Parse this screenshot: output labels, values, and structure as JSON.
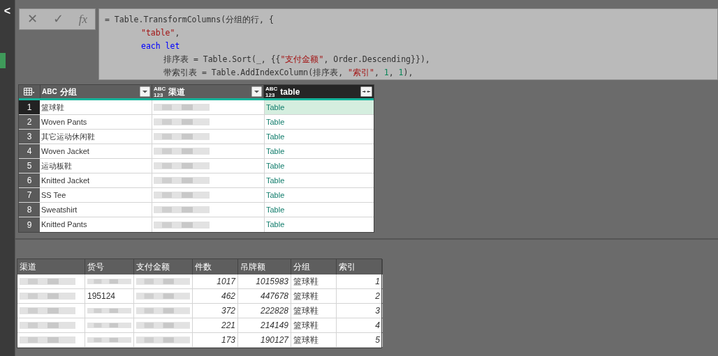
{
  "sidebar": {
    "collapse_icon": "<"
  },
  "formula_bar": {
    "buttons": [
      "✕",
      "✓",
      "fx"
    ],
    "code_lines": [
      {
        "tokens": [
          {
            "kind": "plain",
            "text": "= Table.TransformColumns(分组的行, {"
          }
        ],
        "children": [
          {
            "tokens": [
              {
                "kind": "string",
                "text": "\"table\""
              },
              {
                "kind": "plain",
                "text": ","
              }
            ]
          },
          {
            "tokens": [
              {
                "kind": "keyword",
                "text": "each let"
              }
            ],
            "children": [
              {
                "tokens": [
                  {
                    "kind": "plain",
                    "text": "排序表 = Table.Sort(_, {{"
                  },
                  {
                    "kind": "string",
                    "text": "\"支付金额\""
                  },
                  {
                    "kind": "plain",
                    "text": ", Order.Descending}}),"
                  }
                ]
              },
              {
                "tokens": [
                  {
                    "kind": "plain",
                    "text": "带索引表 = Table.AddIndexColumn(排序表, "
                  },
                  {
                    "kind": "string",
                    "text": "\"索引\""
                  },
                  {
                    "kind": "plain",
                    "text": ", "
                  },
                  {
                    "kind": "number",
                    "text": "1"
                  },
                  {
                    "kind": "plain",
                    "text": ", "
                  },
                  {
                    "kind": "number",
                    "text": "1"
                  },
                  {
                    "kind": "plain",
                    "text": "),"
                  }
                ]
              }
            ]
          }
        ]
      }
    ]
  },
  "grid": {
    "columns": [
      {
        "type": [
          "ABC"
        ],
        "label": "分组",
        "selected": false
      },
      {
        "type": [
          "ABC",
          "123"
        ],
        "label": "渠道",
        "selected": false
      },
      {
        "type": [
          "ABC",
          "123"
        ],
        "label": "table",
        "selected": true
      }
    ],
    "rows": [
      {
        "number": "1",
        "group": "篮球鞋",
        "table": "Table",
        "selected": true
      },
      {
        "number": "2",
        "group": "Woven Pants",
        "table": "Table",
        "selected": false
      },
      {
        "number": "3",
        "group": "其它运动休闲鞋",
        "table": "Table",
        "selected": false
      },
      {
        "number": "4",
        "group": "Woven Jacket",
        "table": "Table",
        "selected": false
      },
      {
        "number": "5",
        "group": "运动板鞋",
        "table": "Table",
        "selected": false
      },
      {
        "number": "6",
        "group": "Knitted Jacket",
        "table": "Table",
        "selected": false
      },
      {
        "number": "7",
        "group": "SS Tee",
        "table": "Table",
        "selected": false
      },
      {
        "number": "8",
        "group": "Sweatshirt",
        "table": "Table",
        "selected": false
      },
      {
        "number": "9",
        "group": "Knitted Pants",
        "table": "Table",
        "selected": false
      }
    ]
  },
  "preview": {
    "columns": [
      "渠道",
      "货号",
      "支付金额",
      "件数",
      "吊牌额",
      "分组",
      "索引"
    ],
    "rows": [
      [
        {
          "kind": "blurred"
        },
        {
          "kind": "blurred"
        },
        {
          "kind": "blurred"
        },
        {
          "kind": "number",
          "text": "1017"
        },
        {
          "kind": "number",
          "text": "1015983"
        },
        {
          "kind": "text",
          "text": "篮球鞋"
        },
        {
          "kind": "number",
          "text": "1"
        }
      ],
      [
        {
          "kind": "blurred"
        },
        {
          "kind": "text",
          "text": "195124"
        },
        {
          "kind": "blurred"
        },
        {
          "kind": "number",
          "text": "462"
        },
        {
          "kind": "number",
          "text": "447678"
        },
        {
          "kind": "text",
          "text": "篮球鞋"
        },
        {
          "kind": "number",
          "text": "2"
        }
      ],
      [
        {
          "kind": "blurred"
        },
        {
          "kind": "blurred"
        },
        {
          "kind": "blurred"
        },
        {
          "kind": "number",
          "text": "372"
        },
        {
          "kind": "number",
          "text": "222828"
        },
        {
          "kind": "text",
          "text": "篮球鞋"
        },
        {
          "kind": "number",
          "text": "3"
        }
      ],
      [
        {
          "kind": "blurred"
        },
        {
          "kind": "blurred"
        },
        {
          "kind": "blurred"
        },
        {
          "kind": "number",
          "text": "221"
        },
        {
          "kind": "number",
          "text": "214149"
        },
        {
          "kind": "text",
          "text": "篮球鞋"
        },
        {
          "kind": "number",
          "text": "4"
        }
      ],
      [
        {
          "kind": "blurred"
        },
        {
          "kind": "blurred"
        },
        {
          "kind": "blurred"
        },
        {
          "kind": "number",
          "text": "173"
        },
        {
          "kind": "number",
          "text": "190127"
        },
        {
          "kind": "text",
          "text": "篮球鞋"
        },
        {
          "kind": "number",
          "text": "5"
        }
      ]
    ]
  }
}
